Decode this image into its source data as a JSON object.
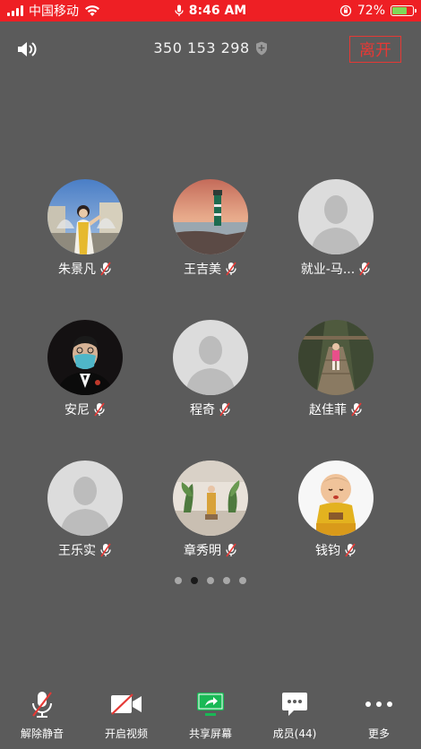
{
  "status_bar": {
    "carrier": "中国移动",
    "time": "8:46 AM",
    "battery_percent": "72%",
    "battery_level": 0.72
  },
  "meeting": {
    "id": "350 153 298",
    "leave_label": "离开"
  },
  "participants": [
    {
      "name": "朱景凡",
      "avatar": "photo-woman-fountain",
      "muted": true
    },
    {
      "name": "王吉美",
      "avatar": "photo-lighthouse",
      "muted": true
    },
    {
      "name": "就业-马...",
      "avatar": "default",
      "muted": true
    },
    {
      "name": "安尼",
      "avatar": "photo-man-mask",
      "muted": true
    },
    {
      "name": "程奇",
      "avatar": "default",
      "muted": true
    },
    {
      "name": "赵佳菲",
      "avatar": "photo-child-bridge",
      "muted": true
    },
    {
      "name": "王乐实",
      "avatar": "default",
      "muted": true
    },
    {
      "name": "章秀明",
      "avatar": "photo-room-plants",
      "muted": true
    },
    {
      "name": "钱钧",
      "avatar": "photo-baby-cartoon",
      "muted": true
    }
  ],
  "pagination": {
    "pages": 5,
    "current": 2
  },
  "toolbar": {
    "unmute_label": "解除静音",
    "video_label": "开启视频",
    "share_label": "共享屏幕",
    "members_label": "成员(44)",
    "more_label": "更多"
  },
  "colors": {
    "status_bar_bg": "#ee1f24",
    "background": "#5b5b5b",
    "leave_red": "#e53935",
    "share_green": "#19b955",
    "mute_red": "#e53935"
  }
}
